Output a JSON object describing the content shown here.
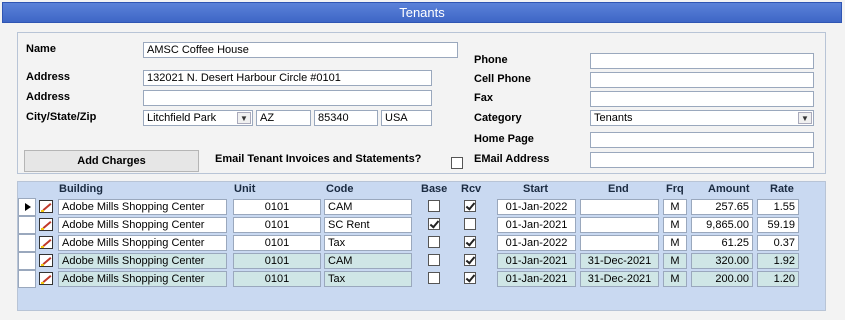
{
  "window": {
    "title": "Tenants"
  },
  "form": {
    "labels": {
      "name": "Name",
      "address1": "Address",
      "address2": "Address",
      "city_state_zip": "City/State/Zip",
      "phone": "Phone",
      "cell_phone": "Cell Phone",
      "fax": "Fax",
      "category": "Category",
      "home_page": "Home Page",
      "email": "EMail Address",
      "email_invoices": "Email Tenant Invoices and Statements?"
    },
    "values": {
      "name": "AMSC Coffee House",
      "address1": "132021 N. Desert Harbour Circle  #0101",
      "address2": "",
      "city": "Litchfield Park",
      "state": "AZ",
      "zip": "85340",
      "country": "USA",
      "phone": "",
      "cell_phone": "",
      "fax": "",
      "category": "Tenants",
      "home_page": "",
      "email": "",
      "email_invoices_checked": false
    },
    "add_charges_label": "Add Charges"
  },
  "grid": {
    "columns": [
      "Building",
      "Unit",
      "Code",
      "Base",
      "Rcv",
      "Start",
      "End",
      "Frq",
      "Amount",
      "Rate"
    ],
    "rows": [
      {
        "building": "Adobe Mills Shopping Center",
        "unit": "0101",
        "code": "CAM",
        "base": false,
        "rcv": true,
        "start": "01-Jan-2022",
        "end": "",
        "frq": "M",
        "amount": "257.65",
        "rate": "1.55",
        "current": true,
        "alt": false
      },
      {
        "building": "Adobe Mills Shopping Center",
        "unit": "0101",
        "code": "SC Rent",
        "base": true,
        "rcv": false,
        "start": "01-Jan-2021",
        "end": "",
        "frq": "M",
        "amount": "9,865.00",
        "rate": "59.19",
        "current": false,
        "alt": false
      },
      {
        "building": "Adobe Mills Shopping Center",
        "unit": "0101",
        "code": "Tax",
        "base": false,
        "rcv": true,
        "start": "01-Jan-2022",
        "end": "",
        "frq": "M",
        "amount": "61.25",
        "rate": "0.37",
        "current": false,
        "alt": false
      },
      {
        "building": "Adobe Mills Shopping Center",
        "unit": "0101",
        "code": "CAM",
        "base": false,
        "rcv": true,
        "start": "01-Jan-2021",
        "end": "31-Dec-2021",
        "frq": "M",
        "amount": "320.00",
        "rate": "1.92",
        "current": false,
        "alt": true
      },
      {
        "building": "Adobe Mills Shopping Center",
        "unit": "0101",
        "code": "Tax",
        "base": false,
        "rcv": true,
        "start": "01-Jan-2021",
        "end": "31-Dec-2021",
        "frq": "M",
        "amount": "200.00",
        "rate": "1.20",
        "current": false,
        "alt": true
      }
    ]
  }
}
